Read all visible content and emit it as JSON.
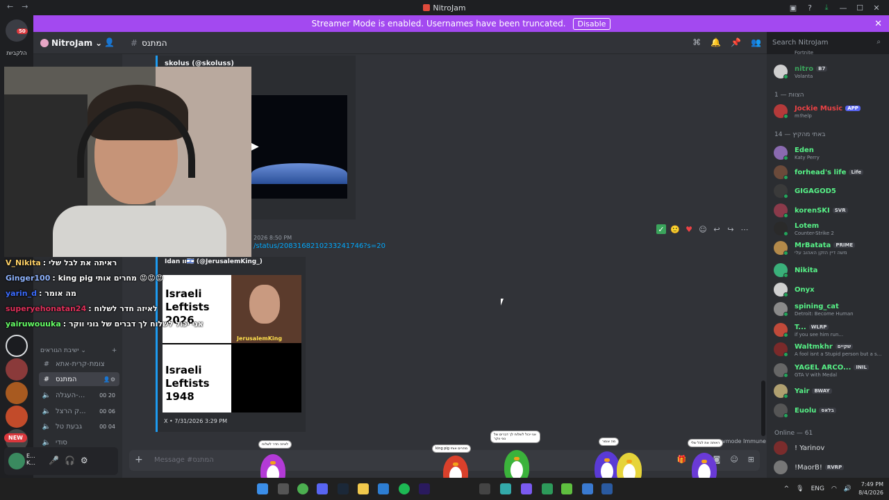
{
  "window": {
    "title": "NitroJam"
  },
  "banner": {
    "text": "Streamer Mode is enabled. Usernames have been truncated.",
    "button": "Disable"
  },
  "header": {
    "guild_name": "NitroJam",
    "channel_name": "המתנס",
    "search_placeholder": "Search NitroJam"
  },
  "servers": {
    "badge": "50",
    "label": "הלקביות"
  },
  "stream_chat": [
    {
      "user": "V_Nikita",
      "message": "ראיתה את לבל שלי",
      "color": "#ffd166"
    },
    {
      "user": "Ginger100",
      "message": "king pig מחרים אותי 😡😡😡",
      "color": "#8fb4ff"
    },
    {
      "user": "yarin_d",
      "message": "מה אומר",
      "color": "#3b6cff"
    },
    {
      "user": "superyehonatan24",
      "message": "לאיזה חדר לשלוח",
      "color": "#e0305a"
    },
    {
      "user": "yairuwouuka",
      "message": "אני יכול לשלוח לך דברים של גוני ווקר",
      "color": "#66ff66"
    }
  ],
  "messages": {
    "embed1_author": "skolus (@skoluss)",
    "msg2_timestamp": "2026 8:50 PM",
    "msg2_link": "/status/2083168210233241746?s=20",
    "embed2_author": "Idan ıı🇮🇱 (@JerusalemKing_)",
    "meme_top": "Israeli Leftists 2026",
    "meme_bottom": "Israeli Leftists 1948",
    "meme_watermark": "JerusalemKing",
    "embed2_footer": "X • 7/31/2026 3:29 PM"
  },
  "channels": {
    "category": "ישיבת הגוראים",
    "items": [
      {
        "icon": "#",
        "name": "צומת-קרית-אתא",
        "selected": false
      },
      {
        "icon": "#",
        "name": "המתנס",
        "selected": true
      },
      {
        "icon": "🔈",
        "name": "העגלה-...",
        "c1": "00",
        "c2": "20"
      },
      {
        "icon": "🔈",
        "name": "ק הרצל...",
        "c1": "00",
        "c2": "06"
      },
      {
        "icon": "🔈",
        "name": "גבעת טל",
        "c1": "00",
        "c2": "04"
      },
      {
        "icon": "🔈",
        "name": "סודי"
      }
    ]
  },
  "user_panel": {
    "name_top": "E...",
    "name_bottom": "K...",
    "new_badge": "NEW"
  },
  "composer": {
    "placeholder": "Message #המתנס",
    "immune_text": "vmode Immune"
  },
  "members": {
    "top": [
      {
        "name": "Fortnite",
        "color": "#949ba4"
      },
      {
        "name": "nitro",
        "tag": "B7",
        "status": "Volanta",
        "color": "#3ba55c"
      }
    ],
    "cat1": "הצוות — 1",
    "staff": [
      {
        "name": "Jockie Music",
        "tag": "APP",
        "status": "m!help",
        "color": "#ed4245"
      }
    ],
    "cat2": "באתי מהקיץ — 14",
    "group": [
      {
        "name": "Eden",
        "status": "Katy Perry",
        "color": "#57f287"
      },
      {
        "name": "forhead's life",
        "tag": "Life",
        "color": "#57f287"
      },
      {
        "name": "GIGAGOD5",
        "color": "#57f287"
      },
      {
        "name": "korenSKI",
        "tag": "SVR",
        "color": "#57f287"
      },
      {
        "name": "Lotem",
        "status": "Counter-Strike 2",
        "color": "#57f287"
      },
      {
        "name": "MrBatata",
        "tag": "PRIME",
        "status": "משה דיין הזקן האהוב עלי",
        "color": "#57f287"
      },
      {
        "name": "Nikita",
        "color": "#57f287"
      },
      {
        "name": "Onyx",
        "color": "#57f287"
      },
      {
        "name": "spining_cat",
        "status": "Detroit: Become Human",
        "color": "#57f287"
      },
      {
        "name": "T...",
        "tag": "WLRP",
        "status": "if you see him run...",
        "color": "#57f287"
      },
      {
        "name": "Waltmkhr",
        "tag": "שקיים",
        "status": "A fool isnt a Stupid person but a s...",
        "color": "#57f287"
      },
      {
        "name": "YAGEL ARCO...",
        "tag": "INIL",
        "status": "GTA V with Medal",
        "color": "#57f287"
      },
      {
        "name": "Yair",
        "tag": "BWAY",
        "color": "#57f287"
      },
      {
        "name": "Euolu",
        "tag": "בלאס",
        "color": "#57f287"
      }
    ],
    "cat3": "Online — 61",
    "online": [
      {
        "name": "! Yarinov",
        "color": "#dbdee1"
      },
      {
        "name": "!MaorB!",
        "tag": "RVRP",
        "color": "#dbdee1"
      }
    ]
  },
  "bubbles": [
    "לאיזה חדר לשלוח",
    "king pig מחרים אותי",
    "אני יכול לשלוח לך דברים של גוני ווקר",
    "מה אומר",
    "ראיתה את לבל שלי"
  ],
  "taskbar": {
    "lang": "ENG",
    "time": "7:49 PM",
    "date": "8/4/2026"
  }
}
